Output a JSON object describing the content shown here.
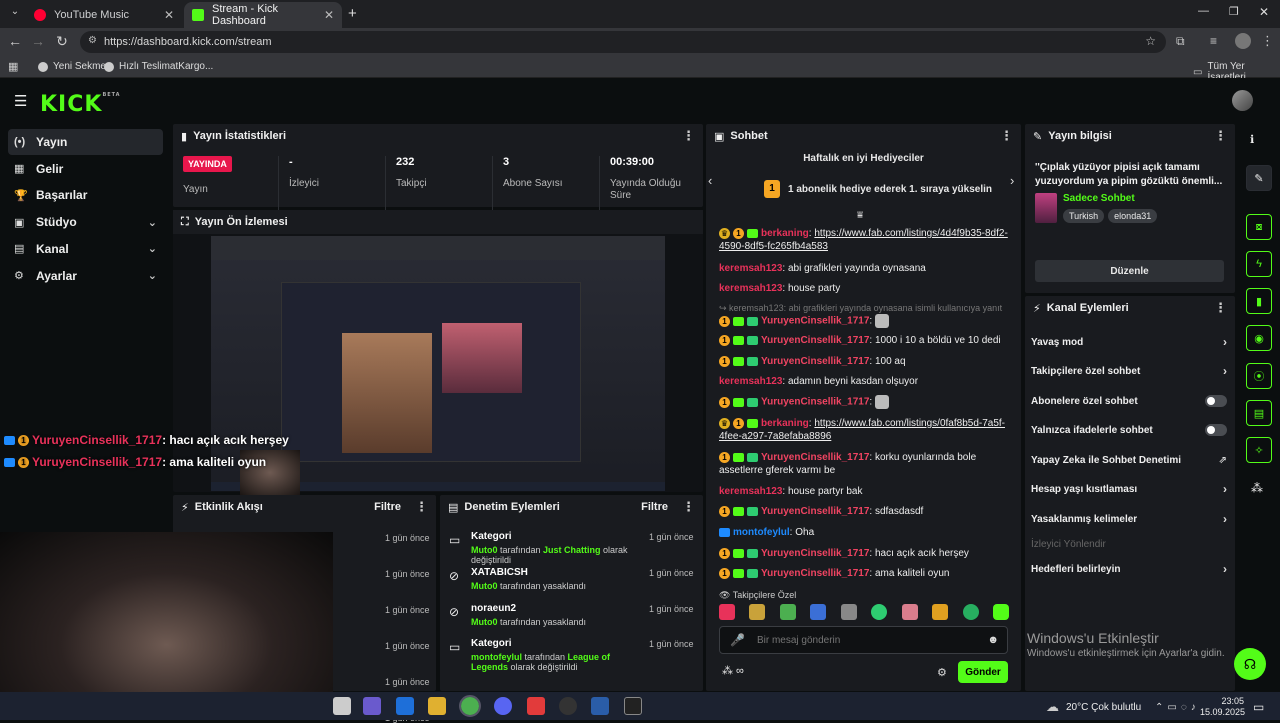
{
  "browser": {
    "tabs": [
      {
        "label": "YouTube Music",
        "color": "#ff0033"
      },
      {
        "label": "Stream - Kick Dashboard",
        "color": "#53fc18"
      }
    ],
    "url": "https://dashboard.kick.com/stream",
    "bookmarks": [
      "Yeni Sekme",
      "Hızlı TeslimatKargo..."
    ],
    "bookmarks_right": "Tüm Yer İşaretleri"
  },
  "brand": {
    "logo": "KICK",
    "logo_sup": "BETA",
    "accent": "#53fc18"
  },
  "nav": [
    {
      "label": "Yayın",
      "icon": "stream-icon",
      "glyph": "(•)",
      "selected": true,
      "chev": false
    },
    {
      "label": "Gelir",
      "icon": "revenue-icon",
      "glyph": "▦",
      "chev": false
    },
    {
      "label": "Başarılar",
      "icon": "trophy-icon",
      "glyph": "🏆",
      "chev": false
    },
    {
      "label": "Stüdyo",
      "icon": "studio-icon",
      "glyph": "▣",
      "chev": true
    },
    {
      "label": "Kanal",
      "icon": "channel-icon",
      "glyph": "▤",
      "chev": true
    },
    {
      "label": "Ayarlar",
      "icon": "gear-icon",
      "glyph": "⚙",
      "chev": true
    }
  ],
  "stats": {
    "title": "Yayın İstatistikleri",
    "live_badge": "YAYINDA",
    "items": [
      {
        "value": "",
        "label": "Yayın"
      },
      {
        "value": "-",
        "label": "İzleyici"
      },
      {
        "value": "232",
        "label": "Takipçi"
      },
      {
        "value": "3",
        "label": "Abone Sayısı"
      },
      {
        "value": "00:39:00",
        "label": "Yayında Olduğu Süre"
      }
    ]
  },
  "preview": {
    "title": "Yayın Ön İzlemesi"
  },
  "activity": {
    "title": "Etkinlik Akışı",
    "filter": "Filtre",
    "rows": [
      "1 gün önce",
      "1 gün önce",
      "1 gün önce",
      "1 gün önce",
      "1 gün önce",
      "1 gün önce"
    ]
  },
  "moderation": {
    "title": "Denetim Eylemleri",
    "filter": "Filtre",
    "rows": [
      {
        "title": "Kategori",
        "user": "Muto0",
        "mid": " tarafından ",
        "target": "Just Chatting",
        "tail": " olarak değiştirildi",
        "time": "1 gün önce"
      },
      {
        "title": "XATABICSH",
        "user": "Muto0",
        "mid": " tarafından yasaklandı",
        "target": "",
        "tail": "",
        "time": "1 gün önce"
      },
      {
        "title": "noraeun2",
        "user": "Muto0",
        "mid": " tarafından yasaklandı",
        "target": "",
        "tail": "",
        "time": "1 gün önce"
      },
      {
        "title": "Kategori",
        "user": "montofeylul",
        "mid": " tarafından ",
        "target": "League of Legends",
        "tail": " olarak değiştirildi",
        "time": "1 gün önce"
      }
    ]
  },
  "chat": {
    "title": "Sohbet",
    "gifters_title": "Haftalık en iyi Hediyeciler",
    "gifters_rank": "1",
    "gifters_text": "1 abonelik hediye ederek 1. sıraya yükselin",
    "messages": [
      {
        "user": "berkaning",
        "cls": "u-red",
        "text": "https://www.fab.com/listings/4d4f9b35-8df2-4590-8df5-fc265fb4a583",
        "link": true
      },
      {
        "user": "keremsah123",
        "cls": "u-red",
        "text": "abi grafikleri yayında oynasana"
      },
      {
        "user": "keremsah123",
        "cls": "u-red",
        "text": "house party"
      },
      {
        "user": "",
        "cls": "",
        "text": "↪ keremsah123: abi grafikleri yayında oynasana isimli kullanıcıya yanıt v...",
        "reply": true
      },
      {
        "user": "YuruyenCinsellik_1717",
        "cls": "u-red2",
        "text": ""
      },
      {
        "user": "YuruyenCinsellik_1717",
        "cls": "u-red2",
        "text": "1000 i 10 a böldü ve 10 dedi"
      },
      {
        "user": "YuruyenCinsellik_1717",
        "cls": "u-red2",
        "text": "100 aq"
      },
      {
        "user": "keremsah123",
        "cls": "u-red",
        "text": "adamın beyni kasdan olşuyor"
      },
      {
        "user": "YuruyenCinsellik_1717",
        "cls": "u-red2",
        "text": ""
      },
      {
        "user": "berkaning",
        "cls": "u-red",
        "text": "https://www.fab.com/listings/0faf8b5d-7a5f-4fee-a297-7a8efaba8896",
        "link": true
      },
      {
        "user": "YuruyenCinsellik_1717",
        "cls": "u-red2",
        "text": "korku oyunlarında bole assetlerre gferek varmı be"
      },
      {
        "user": "keremsah123",
        "cls": "u-red",
        "text": "house partyr bak"
      },
      {
        "user": "YuruyenCinsellik_1717",
        "cls": "u-red2",
        "text": "sdfasdasdf"
      },
      {
        "user": "montofeylul",
        "cls": "u-blue",
        "text": "Oha"
      },
      {
        "user": "YuruyenCinsellik_1717",
        "cls": "u-red2",
        "text": "hacı açık acık herşey"
      },
      {
        "user": "YuruyenCinsellik_1717",
        "cls": "u-red2",
        "text": "ama kaliteli oyun"
      }
    ],
    "followers_only": "Takipçilere Özel",
    "input_placeholder": "Bir mesaj gönderin",
    "send_label": "Gönder"
  },
  "stream_info": {
    "title": "Yayın bilgisi",
    "stream_title": "''Çıplak yüzüyor pipisi açık tamamı yuzuyordum ya pipim gözüktü önemli...",
    "category": "Sadece Sohbet",
    "tags": [
      "Turkish",
      "elonda31"
    ],
    "edit_label": "Düzenle"
  },
  "channel_actions": {
    "title": "Kanal Eylemleri",
    "rows": [
      {
        "label": "Yavaş mod",
        "kind": "chev"
      },
      {
        "label": "Takipçilere özel sohbet",
        "kind": "chev"
      },
      {
        "label": "Abonelere özel sohbet",
        "kind": "toggle"
      },
      {
        "label": "Yalnızca ifadelerle sohbet",
        "kind": "toggle"
      },
      {
        "label": "Yapay Zeka ile Sohbet Denetimi",
        "kind": "ext"
      },
      {
        "label": "Hesap yaşı kısıtlaması",
        "kind": "chev"
      },
      {
        "label": "Yasaklanmış kelimeler",
        "kind": "chev"
      }
    ],
    "section_label": "İzleyici Yönlendir",
    "targets_label": "Hedefleri belirleyin"
  },
  "overlay_chat": [
    {
      "user": "YuruyenCinsellik_1717",
      "text": ": hacı açık acık herşey"
    },
    {
      "user": "YuruyenCinsellik_1717",
      "text": ": ama kaliteli oyun"
    }
  ],
  "watermark": {
    "title": "Windows'u Etkinleştir",
    "sub": "Windows'u etkinleştirmek için Ayarlar'a gidin."
  },
  "taskbar": {
    "weather": "20°C  Çok bulutlu",
    "time": "23:05",
    "date": "15.09.2025"
  }
}
